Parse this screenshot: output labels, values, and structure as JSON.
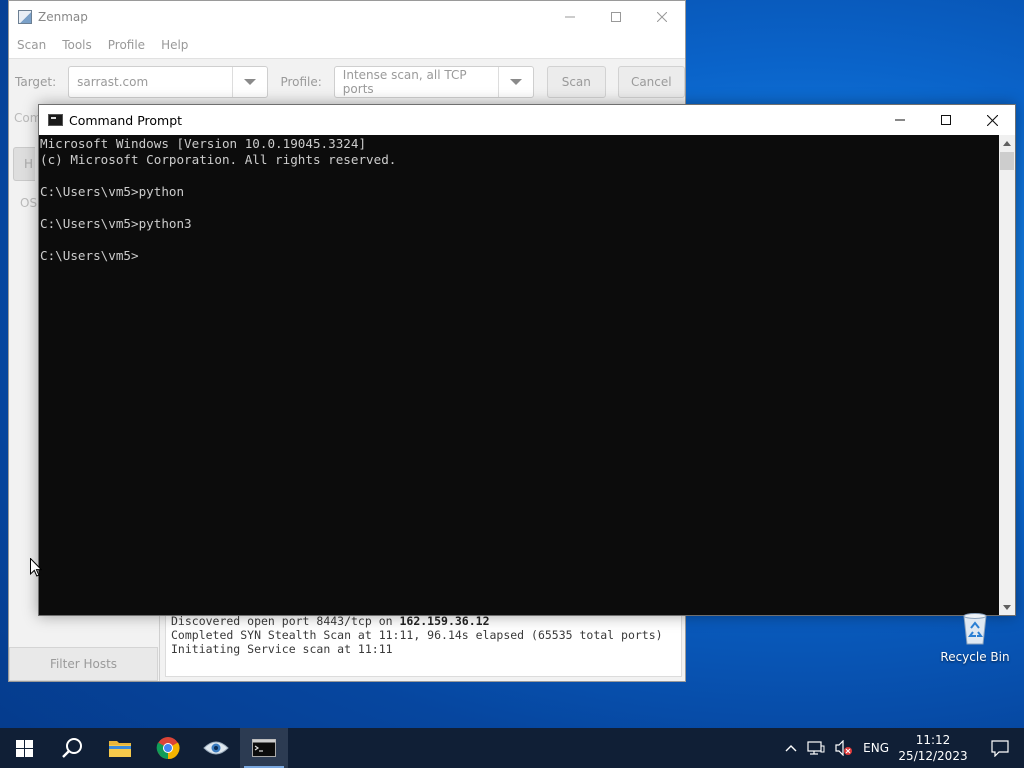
{
  "zenmap": {
    "title": "Zenmap",
    "menu": [
      "Scan",
      "Tools",
      "Profile",
      "Help"
    ],
    "target_label": "Target:",
    "target_value": "sarrast.com",
    "profile_label": "Profile:",
    "profile_value": "Intense scan, all TCP ports",
    "scan_button": "Scan",
    "cancel_button": "Cancel",
    "command_label_fragment": "Com",
    "hosts_tab_fragment": "H",
    "os_fragment": "OS",
    "filter_hosts": "Filter Hosts",
    "output_lines": [
      {
        "prefix": "Discovered open port 8443/tcp on ",
        "bold": "162.159.36.12"
      },
      {
        "prefix": "Completed SYN Stealth Scan at 11:11, 96.14s elapsed (65535 total ports)",
        "bold": ""
      },
      {
        "prefix": "Initiating Service scan at 11:11",
        "bold": ""
      }
    ]
  },
  "cmd": {
    "title": "Command Prompt",
    "lines": [
      "Microsoft Windows [Version 10.0.19045.3324]",
      "(c) Microsoft Corporation. All rights reserved.",
      "",
      "C:\\Users\\vm5>python",
      "",
      "C:\\Users\\vm5>python3",
      "",
      "C:\\Users\\vm5>"
    ]
  },
  "desktop": {
    "recycle_bin": "Recycle Bin"
  },
  "taskbar": {
    "apps": [
      "start-icon",
      "search-icon",
      "file-explorer-icon",
      "chrome-icon",
      "zenmap-icon",
      "command-prompt-icon"
    ],
    "language": "ENG",
    "time": "11:12",
    "date": "25/12/2023"
  }
}
